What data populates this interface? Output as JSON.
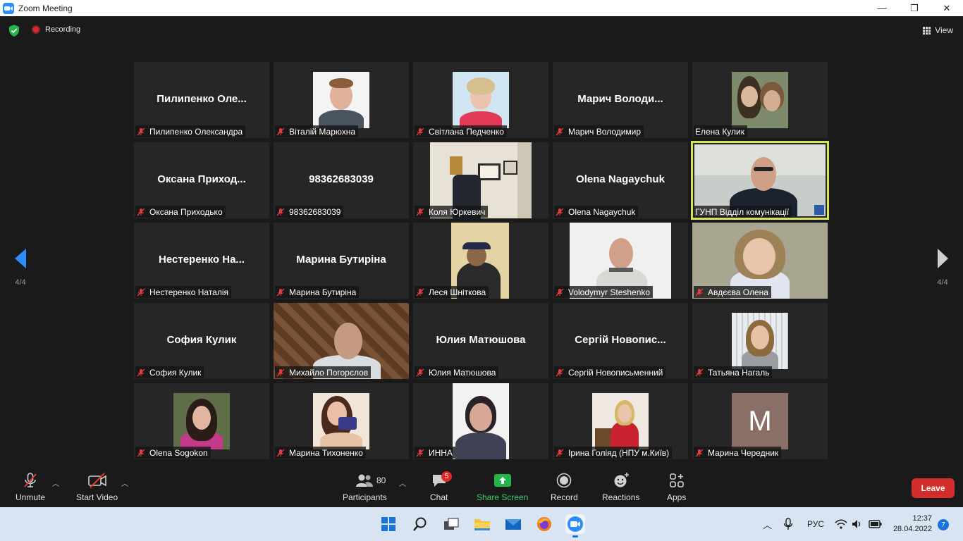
{
  "window": {
    "title": "Zoom Meeting",
    "minimize": "—",
    "restore": "❐",
    "close": "✕"
  },
  "topbar": {
    "recording_label": "Recording",
    "view_label": "View"
  },
  "nav": {
    "page_left": "4/4",
    "page_right": "4/4"
  },
  "tiles": [
    {
      "big": "Пилипенко  Оле...",
      "label": "Пилипенко Олександра"
    },
    {
      "big": "",
      "label": "Віталій Марюхна"
    },
    {
      "big": "",
      "label": "Світлана Педченко"
    },
    {
      "big": "Марич  Володи...",
      "label": "Марич Володимир"
    },
    {
      "big": "",
      "label": "Елена Кулик"
    },
    {
      "big": "Оксана  Приход...",
      "label": "Оксана Приходько"
    },
    {
      "big": "98362683039",
      "label": "98362683039"
    },
    {
      "big": "",
      "label": "Коля Юркевич"
    },
    {
      "big": "Olena Nagaychuk",
      "label": "Olena Nagaychuk"
    },
    {
      "big": "",
      "label": "ГУНП Відділ комунікації"
    },
    {
      "big": "Нестеренко  На...",
      "label": "Нестеренко Наталія"
    },
    {
      "big": "Марина Бутиріна",
      "label": "Марина Бутиріна"
    },
    {
      "big": "",
      "label": "Леся Шніткова"
    },
    {
      "big": "",
      "label": "Volodymyr Steshenko"
    },
    {
      "big": "",
      "label": "Авдєєва Олена"
    },
    {
      "big": "София Кулик",
      "label": "София Кулик"
    },
    {
      "big": "",
      "label": "Михайло Погорєлов"
    },
    {
      "big": "Юлия Матюшова",
      "label": "Юлия Матюшова"
    },
    {
      "big": "Сергій  Новопис...",
      "label": "Сергій Новописьменний"
    },
    {
      "big": "",
      "label": "Татьяна Нагаль"
    },
    {
      "big": "",
      "label": "Olena Sogokon"
    },
    {
      "big": "",
      "label": "Марина Тихоненко"
    },
    {
      "big": "",
      "label": "ИННА"
    },
    {
      "big": "",
      "label": "Ірина Голіяд (НПУ м.Київ)"
    },
    {
      "big": "",
      "label": "Марина Чередник",
      "avatar_letter": "M"
    }
  ],
  "toolbar": {
    "unmute": "Unmute",
    "start_video": "Start Video",
    "participants": "Participants",
    "participants_count": "80",
    "chat": "Chat",
    "chat_badge": "5",
    "share_screen": "Share Screen",
    "record": "Record",
    "reactions": "Reactions",
    "apps": "Apps",
    "leave": "Leave"
  },
  "taskbar": {
    "language": "РУС",
    "time": "12:37",
    "date": "28.04.2022",
    "notifications": "7"
  },
  "colors": {
    "accent_green": "#3ccf6c",
    "leave_red": "#d42d2d",
    "active_speaker": "#d7e25b",
    "avatar_bg": "#8a6f67"
  }
}
